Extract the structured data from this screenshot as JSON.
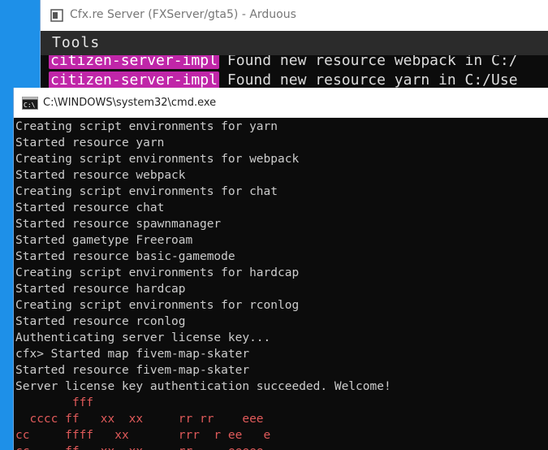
{
  "background_window": {
    "title": "Cfx.re Server (FXServer/gta5) - Arduous",
    "menu_label": "Tools",
    "lines": [
      {
        "tag": "citizen-server-impl",
        "message": "Found new resource webpack in C:/"
      },
      {
        "tag": "citizen-server-impl",
        "message": "Found new resource yarn in C:/Use"
      }
    ]
  },
  "cmd_window": {
    "title": "C:\\WINDOWS\\system32\\cmd.exe",
    "lines": [
      "Creating script environments for yarn",
      "Started resource yarn",
      "Creating script environments for webpack",
      "Started resource webpack",
      "Creating script environments for chat",
      "Started resource chat",
      "Started resource spawnmanager",
      "Started gametype Freeroam",
      "Started resource basic-gamemode",
      "Creating script environments for hardcap",
      "Started resource hardcap",
      "Creating script environments for rconlog",
      "Started resource rconlog",
      "Authenticating server license key...",
      "cfx> Started map fivem-map-skater",
      "Started resource fivem-map-skater",
      "Server license key authentication succeeded. Welcome!"
    ],
    "art_lines": [
      "        fff",
      "  cccc ff   xx  xx     rr rr    eee",
      "cc     ffff   xx       rrr  r ee   e",
      "cc     ff   xx  xx     rr     eeeee"
    ]
  }
}
